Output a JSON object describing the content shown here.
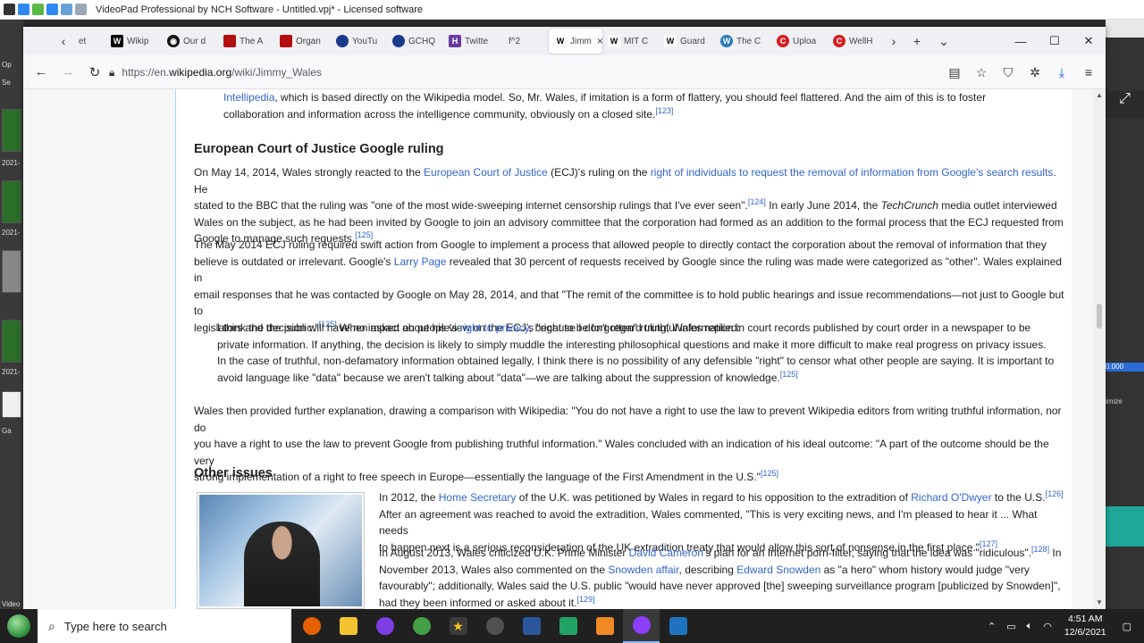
{
  "vp": {
    "title": "VideoPad Professional by NCH Software - Untitled.vpj* - Licensed software",
    "side_labels": [
      "Op",
      "Se",
      "2021-",
      "2021-",
      "2021-",
      "Ga",
      "Video"
    ],
    "right_value": "0.000",
    "right_label": "imize"
  },
  "browser": {
    "tabs": [
      {
        "label": "et",
        "color": "#777777",
        "glyph": ""
      },
      {
        "label": "Wikip",
        "color": "#000000",
        "glyph": "W"
      },
      {
        "label": "Our d",
        "color": "#111111",
        "glyph": "◉"
      },
      {
        "label": "The A",
        "color": "#b40f0f",
        "glyph": "■"
      },
      {
        "label": "Organ",
        "color": "#b40f0f",
        "glyph": "■"
      },
      {
        "label": "YouTu",
        "color": "#1a3a8a",
        "glyph": "◉"
      },
      {
        "label": "GCHQ",
        "color": "#1a3a8a",
        "glyph": "◉"
      },
      {
        "label": "Twitte",
        "color": "#6a3aa0",
        "glyph": "HS"
      },
      {
        "label": "f^2",
        "color": "#f0f0f4",
        "glyph": ""
      },
      {
        "label": "Jimm",
        "color": "#000000",
        "glyph": "W",
        "active": true
      },
      {
        "label": "MIT C",
        "color": "#000000",
        "glyph": "W"
      },
      {
        "label": "Guard",
        "color": "#000000",
        "glyph": "W"
      },
      {
        "label": "The C",
        "color": "#2a7ab8",
        "glyph": "W"
      },
      {
        "label": "Uploa",
        "color": "#d32020",
        "glyph": "C"
      },
      {
        "label": "WellH",
        "color": "#d32020",
        "glyph": "C"
      }
    ],
    "url_prefix": "https://en.",
    "url_domain": "wikipedia.org",
    "url_path": "/wiki/Jimmy_Wales"
  },
  "article": {
    "p0": {
      "link": "Intellipedia",
      "text1": ", which is based directly on the Wikipedia model. So, Mr. Wales, if imitation is a form of flattery, you should feel flattered. And the aim of this is to foster",
      "text2": "collaboration and information across the intelligence community, obviously on a closed site.",
      "ref": "[123]"
    },
    "h_ecj": "European Court of Justice Google ruling",
    "p1": {
      "a": "On May 14, 2014, Wales strongly reacted to the ",
      "l1": "European Court of Justice",
      "b": " (ECJ)'s ruling on the ",
      "l2": "right of individuals to request the removal of information from Google's search results",
      "c": ". He",
      "d": "stated to the BBC that the ruling was \"one of the most wide-sweeping internet censorship rulings that I've ever seen\".",
      "r1": "[124]",
      "e": " In early June 2014, the ",
      "em": "TechCrunch",
      "f": " media outlet interviewed",
      "g": "Wales on the subject, as he had been invited by Google to join an advisory committee that the corporation had formed as an addition to the formal process that the ECJ requested from",
      "h": "Google to manage such requests.",
      "r2": "[125]"
    },
    "p2": {
      "a": "The May 2014 ECJ ruling required swift action from Google to implement a process that allowed people to directly contact the corporation about the removal of information that they",
      "b": "believe is outdated or irrelevant. Google's ",
      "l1": "Larry Page",
      "c": " revealed that 30 percent of requests received by Google since the ruling was made were categorized as \"other\". Wales explained in",
      "d": "email responses that he was contacted by Google on May 28, 2014, and that \"The remit of the committee is to hold public hearings and issue recommendations—not just to Google but to",
      "e": "legislators and the public.\"",
      "r1": "[125]",
      "f": " When asked about his view on the ECJ's \"right to be forgotten\" ruling, Wales replied:"
    },
    "quote": {
      "a": "I think the decision will have no impact on people's ",
      "l1": "right to privacy",
      "b": ", because I don't regard truthful information in court records published by court order in a newspaper to be",
      "c": "private information. If anything, the decision is likely to simply muddle the interesting philosophical questions and make it more difficult to make real progress on privacy issues.",
      "d": "In the case of truthful, non-defamatory information obtained legally, I think there is no possibility of any defensible \"right\" to censor what other people are saying. It is important to",
      "e": "avoid language like \"data\" because we aren't talking about \"data\"—we are talking about the suppression of knowledge.",
      "r1": "[125]"
    },
    "p3": {
      "a": "Wales then provided further explanation, drawing a comparison with Wikipedia: \"You do not have a right to use the law to prevent Wikipedia editors from writing truthful information, nor do",
      "b": "you have a right to use the law to prevent Google from publishing truthful information.\" Wales concluded with an indication of his ideal outcome: \"A part of the outcome should be the very",
      "c": "strong implementation of a right to free speech in Europe—essentially the language of the First Amendment in the U.S.\"",
      "r1": "[125]"
    },
    "h_other": "Other issues",
    "p4": {
      "a": "In 2012, the ",
      "l1": "Home Secretary",
      "b": " of the U.K. was petitioned by Wales in regard to his opposition to the extradition of ",
      "l2": "Richard O'Dwyer",
      "c": " to the U.S.",
      "r1": "[126]",
      "d": "After an agreement was reached to avoid the extradition, Wales commented, \"This is very exciting news, and I'm pleased to hear it ... What needs",
      "e": "to happen next is a serious reconsideration of the UK extradition treaty that would allow this sort of nonsense in the first place.\"",
      "r2": "[127]"
    },
    "p5": {
      "a": "In August 2013, Wales criticized U.K. Prime Minister ",
      "l1": "David Cameron",
      "b": "'s plan for an Internet porn-filter, saying that the idea was \"ridiculous\".",
      "r1": "[128]",
      "c": " In",
      "d": "November 2013, Wales also commented on the ",
      "l2": "Snowden affair",
      "e": ", describing ",
      "l3": "Edward Snowden",
      "f": " as \"a hero\" whom history would judge \"very",
      "g": "favourably\"; additionally, Wales said the U.S. public \"would have never approved [the] sweeping surveillance program [publicized by Snowden]\",",
      "h": "had they been informed or asked about it.",
      "r2": "[129]"
    }
  },
  "taskbar": {
    "search_placeholder": "Type here to search",
    "time": "4:51 AM",
    "date": "12/6/2021",
    "apps": [
      {
        "name": "firefox",
        "color": "#e66000"
      },
      {
        "name": "file-explorer",
        "color": "#f4c430"
      },
      {
        "name": "purple-app",
        "color": "#7b3fe4"
      },
      {
        "name": "green-app",
        "color": "#43a047"
      },
      {
        "name": "star-app",
        "color": "#f5c518"
      },
      {
        "name": "obs",
        "color": "#505050"
      },
      {
        "name": "word",
        "color": "#2b579a"
      },
      {
        "name": "sheets",
        "color": "#21a366"
      },
      {
        "name": "orange-app",
        "color": "#f08a24"
      },
      {
        "name": "purple-app-2",
        "color": "#8a3ffc",
        "active": true
      },
      {
        "name": "videopad",
        "color": "#1e73be"
      }
    ]
  }
}
